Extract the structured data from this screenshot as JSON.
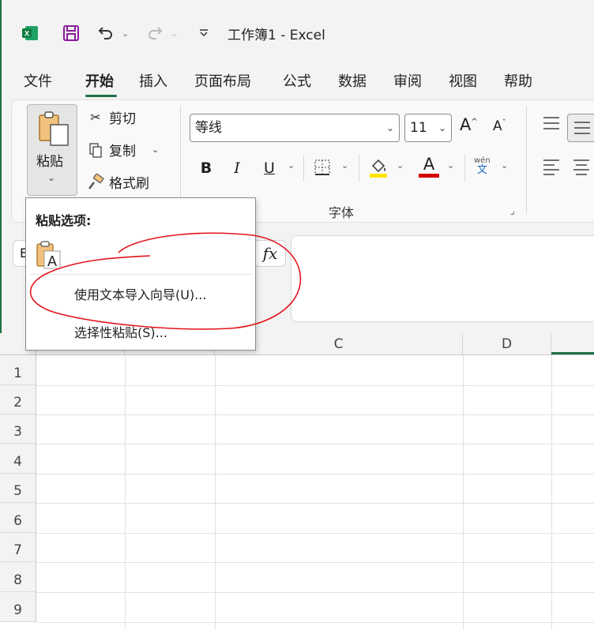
{
  "titlebar": {
    "title": "工作簿1  -  Excel",
    "icons": [
      "excel-logo-icon",
      "save-icon",
      "undo-icon",
      "redo-icon",
      "customize-qat-icon"
    ]
  },
  "tabs": [
    {
      "label": "文件",
      "active": false
    },
    {
      "label": "开始",
      "active": true
    },
    {
      "label": "插入",
      "active": false
    },
    {
      "label": "页面布局",
      "active": false
    },
    {
      "label": "公式",
      "active": false
    },
    {
      "label": "数据",
      "active": false
    },
    {
      "label": "审阅",
      "active": false
    },
    {
      "label": "视图",
      "active": false
    },
    {
      "label": "帮助",
      "active": false
    }
  ],
  "clipboard": {
    "paste_label": "粘贴",
    "cut_label": "剪切",
    "copy_label": "复制",
    "format_painter_label": "格式刷"
  },
  "font_group": {
    "font_name": "等线",
    "font_size": "11",
    "bold": "B",
    "italic": "I",
    "underline": "U",
    "font_color_glyph": "A",
    "phonetic_top": "wén",
    "phonetic_bottom": "文",
    "group_label": "字体"
  },
  "formula_bar": {
    "name_box_partial": "E",
    "fx_label": "fx"
  },
  "columns": [
    "C",
    "D"
  ],
  "rows": [
    "1",
    "2",
    "3",
    "4",
    "5",
    "6",
    "7",
    "8",
    "9"
  ],
  "paste_menu": {
    "title": "粘贴选项:",
    "items": [
      {
        "label": "使用文本导入向导(U)..."
      },
      {
        "label": "选择性粘贴(S)..."
      }
    ]
  },
  "colors": {
    "brand": "#1e7145",
    "fill_highlight": "#ffe600",
    "font_color": "#d40000",
    "annotation": "#e2141c"
  }
}
